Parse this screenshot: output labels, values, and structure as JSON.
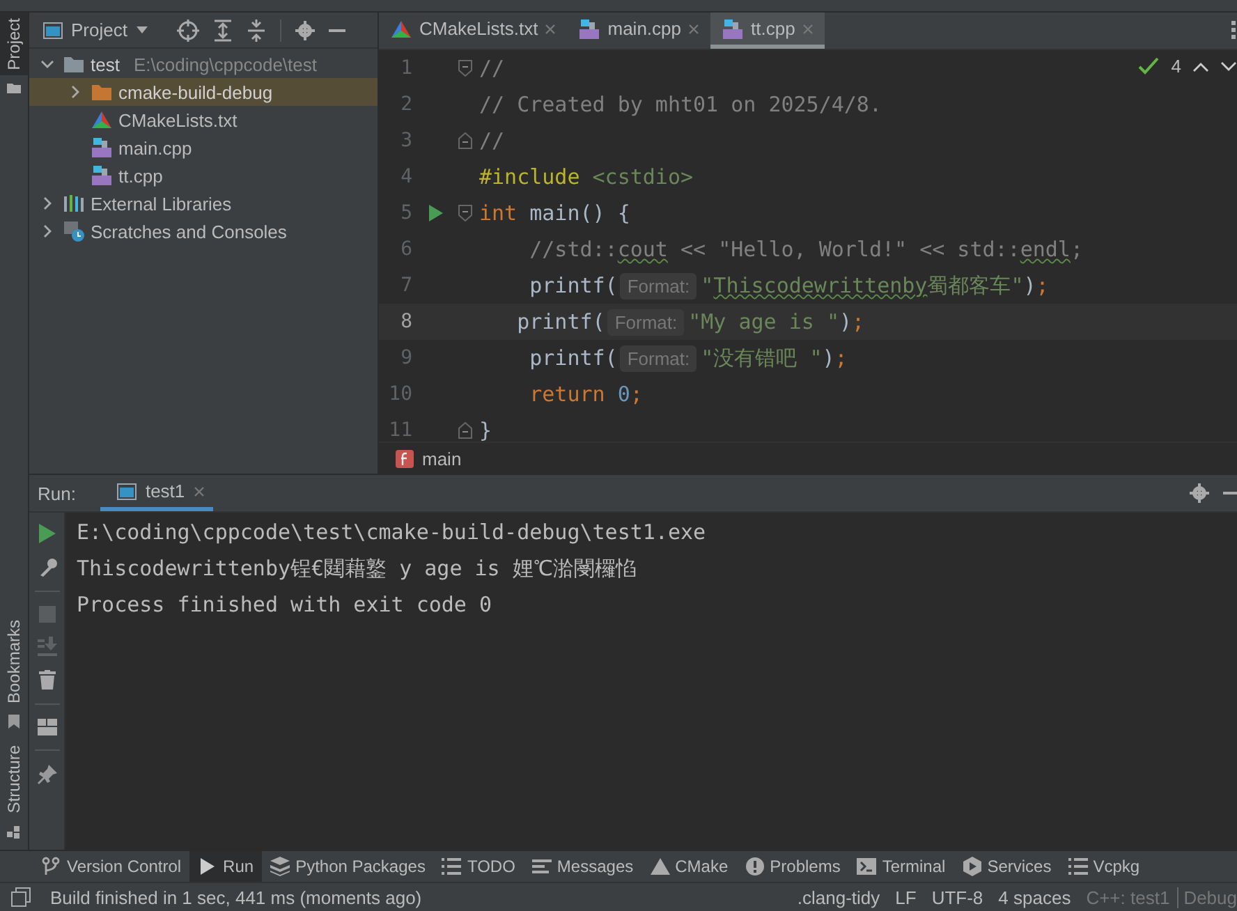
{
  "left_stripe": [
    {
      "label": "Project",
      "selected": true
    },
    {
      "label": "Bookmarks",
      "selected": false
    },
    {
      "label": "Structure",
      "selected": false
    }
  ],
  "project": {
    "title": "Project",
    "tree": [
      {
        "label": "test",
        "path": "E:\\coding\\cppcode\\test",
        "kind": "folder",
        "expanded": true,
        "selected": false,
        "children": [
          {
            "label": "cmake-build-debug",
            "kind": "build-folder",
            "expanded": false,
            "selected": true
          },
          {
            "label": "CMakeLists.txt",
            "kind": "cmake",
            "selected": false
          },
          {
            "label": "main.cpp",
            "kind": "cpp",
            "selected": false
          },
          {
            "label": "tt.cpp",
            "kind": "cpp",
            "selected": false
          }
        ]
      },
      {
        "label": "External Libraries",
        "kind": "library",
        "expanded": false,
        "selected": false
      },
      {
        "label": "Scratches and Consoles",
        "kind": "scratches",
        "expanded": false,
        "selected": false
      }
    ]
  },
  "editor": {
    "tabs": [
      {
        "label": "CMakeLists.txt",
        "kind": "cmake",
        "selected": false
      },
      {
        "label": "main.cpp",
        "kind": "cpp",
        "selected": false
      },
      {
        "label": "tt.cpp",
        "kind": "cpp",
        "selected": true
      }
    ],
    "inspection_count": "4",
    "lines": [
      {
        "number": "1",
        "current": false,
        "fold_start": true,
        "tokens": [
          {
            "kind": "comment",
            "text": "//"
          }
        ]
      },
      {
        "number": "2",
        "current": false,
        "tokens": [
          {
            "kind": "comment",
            "text": "// Created by mht01 on 2025/4/8."
          }
        ]
      },
      {
        "number": "3",
        "current": false,
        "fold_end": true,
        "tokens": [
          {
            "kind": "comment",
            "text": "//"
          }
        ]
      },
      {
        "number": "4",
        "current": false,
        "tokens": [
          {
            "kind": "directive",
            "text": "#include"
          },
          {
            "kind": "header",
            "text": " <cstdio>"
          }
        ]
      },
      {
        "number": "5",
        "current": false,
        "run": true,
        "fold_start": true,
        "tokens": [
          {
            "kind": "keyword",
            "text": "int"
          },
          {
            "kind": "plain",
            "text": " main() {"
          }
        ]
      },
      {
        "number": "6",
        "current": false,
        "tokens": [
          {
            "kind": "comment",
            "text": "    //std::"
          },
          {
            "kind": "comment",
            "text": "cout",
            "squiggle": true
          },
          {
            "kind": "comment",
            "text": " << \"Hello, World!\" << std::"
          },
          {
            "kind": "comment",
            "text": "endl",
            "squiggle": true
          },
          {
            "kind": "comment",
            "text": ";"
          }
        ]
      },
      {
        "number": "7",
        "current": false,
        "tokens": [
          {
            "kind": "plain",
            "text": "    printf("
          },
          {
            "kind": "hint",
            "text": "Format:"
          },
          {
            "kind": "string",
            "text": "\""
          },
          {
            "kind": "string",
            "text": "Thiscodewrittenby",
            "squiggle": true
          },
          {
            "kind": "string",
            "text": "蜀都客车\""
          },
          {
            "kind": "plain",
            "text": ")"
          },
          {
            "kind": "punct",
            "text": ";"
          }
        ]
      },
      {
        "number": "8",
        "current": true,
        "tokens": [
          {
            "kind": "plain",
            "text": "   printf("
          },
          {
            "kind": "hint",
            "text": "Format:"
          },
          {
            "kind": "string",
            "text": "\"My age is \""
          },
          {
            "kind": "plain",
            "text": ")"
          },
          {
            "kind": "punct",
            "text": ";"
          }
        ]
      },
      {
        "number": "9",
        "current": false,
        "tokens": [
          {
            "kind": "plain",
            "text": "    printf("
          },
          {
            "kind": "hint",
            "text": "Format:"
          },
          {
            "kind": "string",
            "text": "\"没有错吧 \""
          },
          {
            "kind": "plain",
            "text": ")"
          },
          {
            "kind": "punct",
            "text": ";"
          }
        ]
      },
      {
        "number": "10",
        "current": false,
        "tokens": [
          {
            "kind": "keyword",
            "text": "    return"
          },
          {
            "kind": "number",
            "text": " 0"
          },
          {
            "kind": "punct",
            "text": ";"
          }
        ]
      },
      {
        "number": "11",
        "current": false,
        "fold_end": true,
        "tokens": [
          {
            "kind": "plain",
            "text": "}"
          }
        ]
      }
    ],
    "breadcrumb": "main"
  },
  "run": {
    "label": "Run:",
    "tabs": [
      {
        "label": "test1",
        "selected": true
      }
    ],
    "console": [
      {
        "text": "E:\\coding\\cppcode\\test\\cmake-build-debug\\test1.exe"
      },
      {
        "text": "Thiscodewrittenby锃€閮藉鐜 y age is 娌℃湁閿欏惂"
      },
      {
        "text": "Process finished with exit code 0"
      }
    ]
  },
  "tool_tabs": [
    {
      "label": "Version Control",
      "kind": "vcs",
      "selected": false
    },
    {
      "label": "Run",
      "kind": "run",
      "selected": true
    },
    {
      "label": "Python Packages",
      "kind": "packages",
      "selected": false
    },
    {
      "label": "TODO",
      "kind": "todo",
      "selected": false
    },
    {
      "label": "Messages",
      "kind": "messages",
      "selected": false
    },
    {
      "label": "CMake",
      "kind": "cmake",
      "selected": false
    },
    {
      "label": "Problems",
      "kind": "problems",
      "selected": false
    },
    {
      "label": "Terminal",
      "kind": "terminal",
      "selected": false
    },
    {
      "label": "Services",
      "kind": "services",
      "selected": false
    },
    {
      "label": "Vcpkg",
      "kind": "vcpkg",
      "selected": false
    }
  ],
  "status_bar": {
    "message": "Build finished in 1 sec, 441 ms (moments ago)",
    "items": [
      {
        "text": ".clang-tidy",
        "disabled": false
      },
      {
        "text": "LF",
        "disabled": false
      },
      {
        "text": "UTF-8",
        "disabled": false
      },
      {
        "text": "4 spaces",
        "disabled": false
      },
      {
        "text": "C++: test1",
        "disabled": true
      },
      {
        "text": "Debug",
        "disabled": true
      }
    ]
  }
}
